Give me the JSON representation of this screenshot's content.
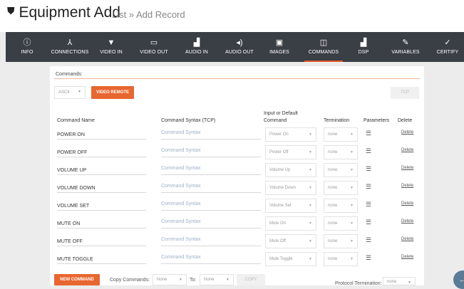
{
  "header": {
    "title": "Equipment Add",
    "breadcrumb": "List » Add Record"
  },
  "nav": {
    "tabs": [
      {
        "label": "INFO",
        "icon": "ⓘ"
      },
      {
        "label": "CONNECTIONS",
        "icon": "⅄"
      },
      {
        "label": "VIDEO IN",
        "icon": "▼"
      },
      {
        "label": "VIDEO OUT",
        "icon": "▭"
      },
      {
        "label": "AUDIO IN",
        "icon": "▟"
      },
      {
        "label": "AUDIO OUT",
        "icon": "◂)"
      },
      {
        "label": "IMAGES",
        "icon": "▣"
      },
      {
        "label": "COMMANDS",
        "icon": "◫"
      },
      {
        "label": "DSP",
        "icon": "▟"
      },
      {
        "label": "VARIABLES",
        "icon": "✎"
      },
      {
        "label": "CERTIFY",
        "icon": "✓"
      }
    ],
    "active": "COMMANDS"
  },
  "commands": {
    "section_label": "Commands:",
    "protocol": "ASCII",
    "video_remote_label": "VIDEO REMOTE",
    "tcp_label": "TCP",
    "columns": {
      "name": "Command Name",
      "syntax": "Command Syntax (TCP)",
      "input_line1": "Input or Default",
      "input_line2": "Command",
      "termination": "Termination",
      "parameters": "Parameters",
      "delete": "Delete"
    },
    "rows": [
      {
        "name": "POWER ON",
        "syntax": "Command Syntax",
        "input": "Power On",
        "termination": "none",
        "delete": "Delete"
      },
      {
        "name": "POWER OFF",
        "syntax": "Command Syntax",
        "input": "Power Off",
        "termination": "none",
        "delete": "Delete"
      },
      {
        "name": "VOLUME UP",
        "syntax": "Command Syntax",
        "input": "Volume Up",
        "termination": "none",
        "delete": "Delete"
      },
      {
        "name": "VOLUME DOWN",
        "syntax": "Command Syntax",
        "input": "Volume Down",
        "termination": "none",
        "delete": "Delete"
      },
      {
        "name": "VOLUME SET",
        "syntax": "Command Syntax",
        "input": "Volume Set",
        "termination": "none",
        "delete": "Delete"
      },
      {
        "name": "MUTE ON",
        "syntax": "Command Syntax",
        "input": "Mute On",
        "termination": "none",
        "delete": "Delete"
      },
      {
        "name": "MUTE OFF",
        "syntax": "Command Syntax",
        "input": "Mute Off",
        "termination": "none",
        "delete": "Delete"
      },
      {
        "name": "MUTE TOGGLE",
        "syntax": "Command Syntax",
        "input": "Mute Toggle",
        "termination": "none",
        "delete": "Delete"
      }
    ],
    "new_command_label": "NEW COMMAND",
    "copy_label": "Copy Commands:",
    "copy_from": "None",
    "to_label": "To:",
    "copy_to": "None",
    "copy_button": "COPY",
    "protocol_termination_label": "Protocol Termination:",
    "protocol_termination": "none"
  },
  "colors": {
    "accent": "#e8662f",
    "nav_bg": "#3a3e45"
  }
}
